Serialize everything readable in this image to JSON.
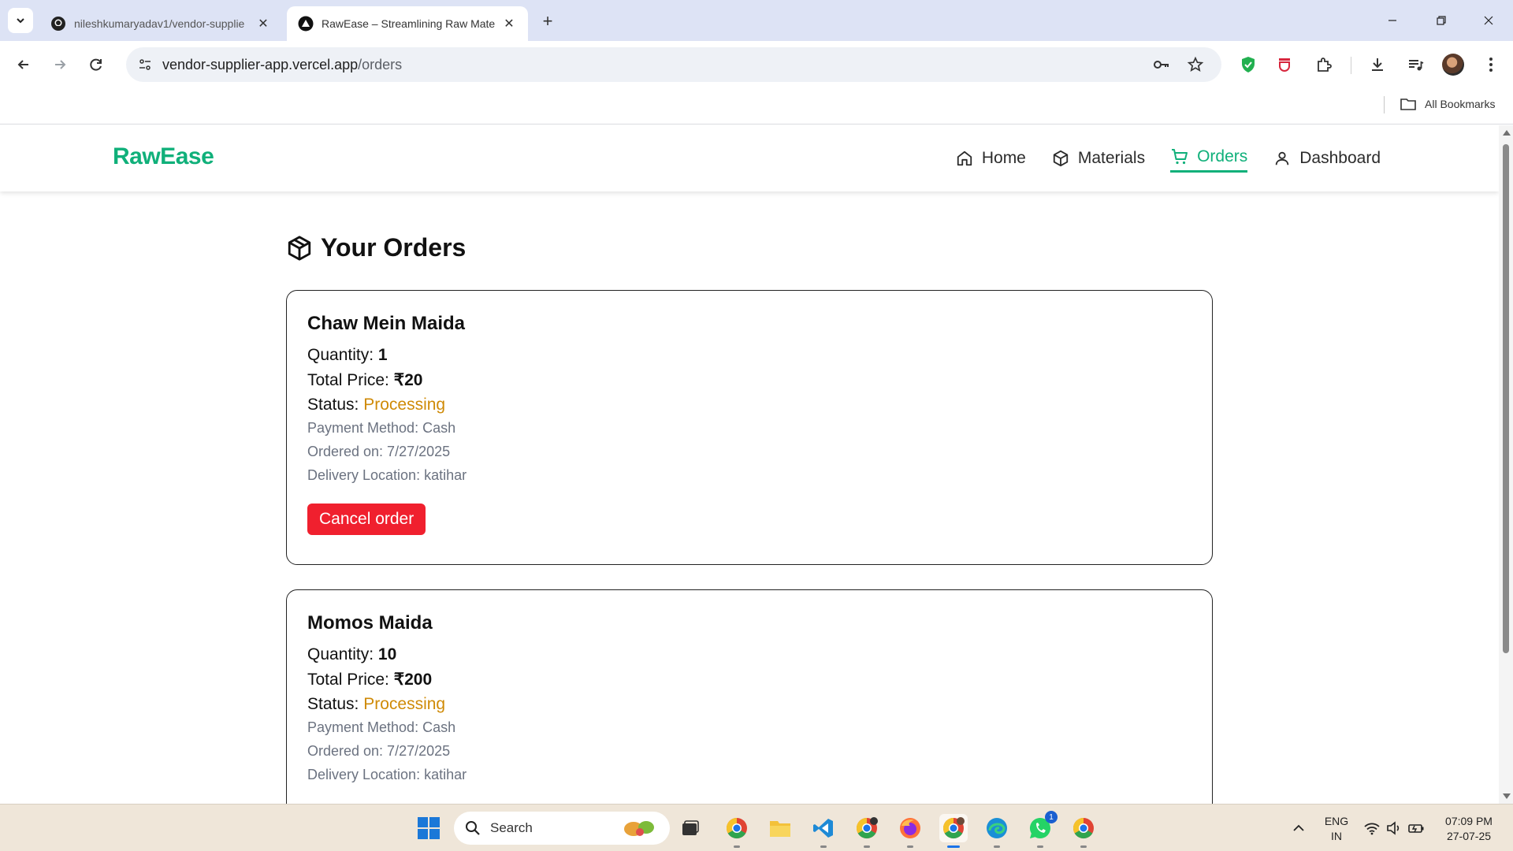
{
  "browser": {
    "tabs": [
      {
        "title": "nileshkumaryadav1/vendor-supplie",
        "active": false
      },
      {
        "title": "RawEase – Streamlining Raw Mate",
        "active": true
      }
    ],
    "url_host": "vendor-supplier-app.vercel.app",
    "url_path": "/orders",
    "bookmarks_label": "All Bookmarks"
  },
  "site": {
    "brand": "RawEase",
    "brand_color": "#10b07a",
    "nav": [
      {
        "label": "Home",
        "icon": "home-icon"
      },
      {
        "label": "Materials",
        "icon": "box-icon"
      },
      {
        "label": "Orders",
        "icon": "cart-icon",
        "active": true
      },
      {
        "label": "Dashboard",
        "icon": "user-icon"
      }
    ]
  },
  "page": {
    "heading": "Your Orders",
    "heading_icon": "package-icon"
  },
  "orders": [
    {
      "name": "Chaw Mein Maida",
      "quantity_label": "Quantity:",
      "quantity": "1",
      "price_label": "Total Price:",
      "price": "₹20",
      "status_label": "Status:",
      "status": "Processing",
      "payment": "Payment Method: Cash",
      "ordered_on": "Ordered on: 7/27/2025",
      "location": "Delivery Location: katihar",
      "cancel_label": "Cancel order"
    },
    {
      "name": "Momos Maida",
      "quantity_label": "Quantity:",
      "quantity": "10",
      "price_label": "Total Price:",
      "price": "₹200",
      "status_label": "Status:",
      "status": "Processing",
      "payment": "Payment Method: Cash",
      "ordered_on": "Ordered on: 7/27/2025",
      "location": "Delivery Location: katihar"
    }
  ],
  "taskbar": {
    "search_label": "Search",
    "lang_top": "ENG",
    "lang_bottom": "IN",
    "time": "07:09 PM",
    "date": "27-07-25",
    "whatsapp_badge": "1"
  }
}
